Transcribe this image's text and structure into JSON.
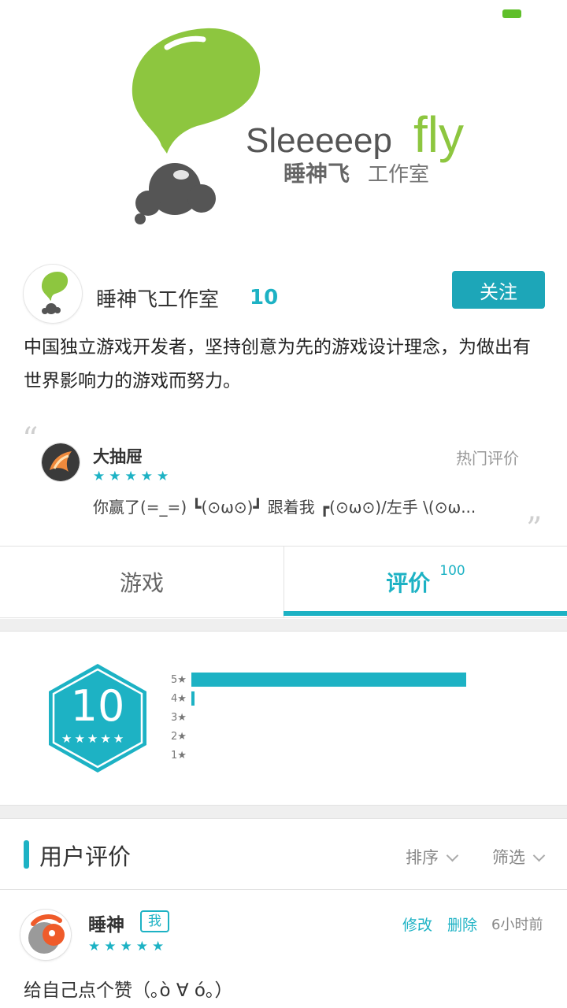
{
  "banner": {
    "logo_word": "Sleeeeep",
    "logo_word_accent": "fly",
    "logo_cn_name": "睡神飞",
    "logo_cn_suffix": "工作室"
  },
  "studio": {
    "name": "睡神飞工作室",
    "score": "10",
    "follow_label": "关注",
    "description": "中国独立游戏开发者，坚持创意为先的游戏设计理念，为做出有世界影响力的游戏而努力。"
  },
  "hot_review": {
    "user": "大抽屉",
    "label": "热门评价",
    "stars": 5,
    "text": "你赢了(=_=) ┗(⊙ω⊙)┛ 跟着我 ┏(⊙ω⊙)/左手 \\(⊙ω..."
  },
  "tabs": [
    {
      "label": "游戏"
    },
    {
      "label": "评价",
      "count": "100",
      "active": true
    }
  ],
  "rating": {
    "score": "10",
    "distribution": [
      {
        "label": "5★",
        "share": 0.97
      },
      {
        "label": "4★",
        "share": 0.01
      },
      {
        "label": "3★",
        "share": 0
      },
      {
        "label": "2★",
        "share": 0
      },
      {
        "label": "1★",
        "share": 0
      }
    ]
  },
  "user_reviews": {
    "title": "用户评价",
    "sort_label": "排序",
    "filter_label": "筛选",
    "items": [
      {
        "user": "睡神",
        "badge": "我",
        "edit_label": "修改",
        "delete_label": "删除",
        "time": "6小时前",
        "stars": 5,
        "text": "给自己点个赞（｡ò ∀ ó｡）"
      }
    ]
  },
  "colors": {
    "accent": "#1db2c4",
    "brand_green": "#8dc63f",
    "logo_gray": "#555555"
  }
}
